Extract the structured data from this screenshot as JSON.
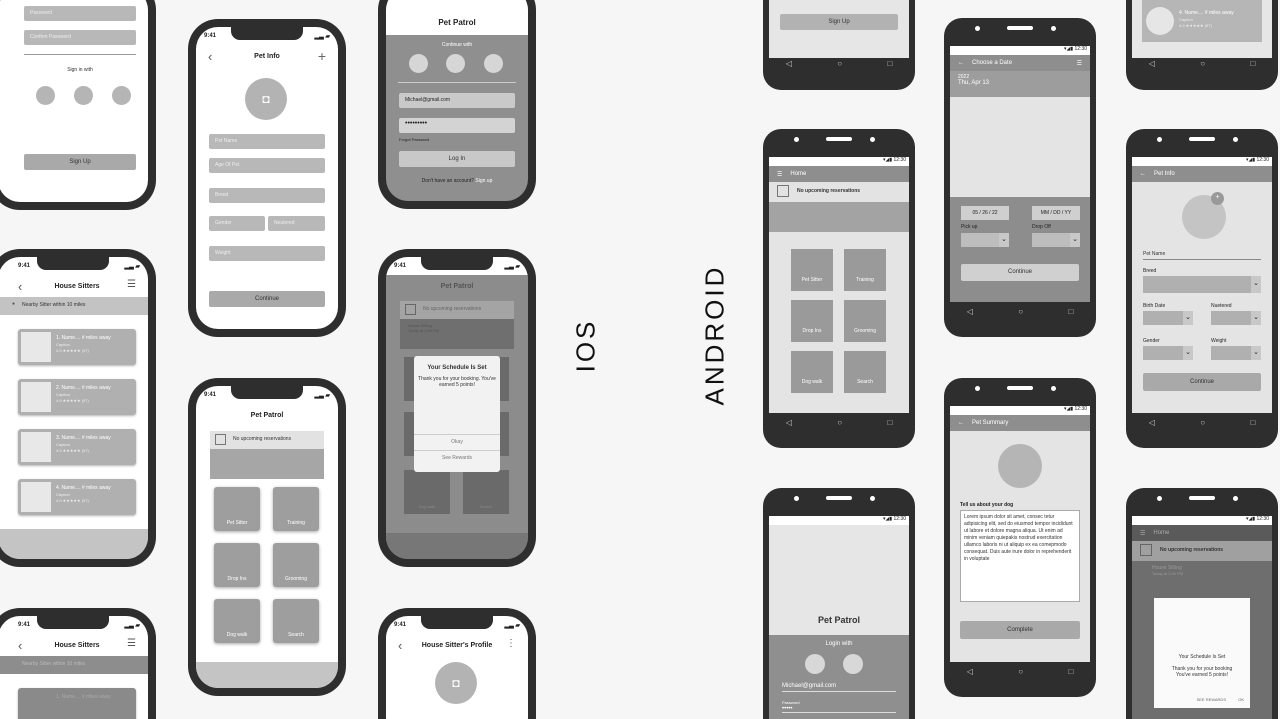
{
  "labels": {
    "ios": "IOS",
    "android": "ANDROID"
  },
  "time": "9:41",
  "android_time": "12:30",
  "icons": {
    "signal": "signal-wifi-battery-icon"
  },
  "ios1": {
    "password": "Password",
    "confirm": "Confirm Password",
    "sign_in_with": "Sign in with",
    "signup": "Sign Up"
  },
  "ios_petinfo": {
    "title": "Pet Info",
    "fields": [
      "Pet Name",
      "Age Of Pet",
      "Breed",
      "Gender",
      "Neutered",
      "Weight"
    ],
    "continue": "Continue"
  },
  "ios_login": {
    "title": "Pet Patrol",
    "continue_with": "Continue with",
    "email": "Michael@gmail.com",
    "password": "•••••••••",
    "forgot": "Forgot Password",
    "login": "Log In",
    "no_account": "Don't have an account?",
    "signup_link": "Sign up"
  },
  "ios_sitters": {
    "title": "House Sitters",
    "nearby": "Nearby Sitter within 10 miles",
    "items": [
      {
        "name": "1. Name.... # miles away",
        "caption": "Caption",
        "stars": "4.9 ★★★★★ (97)"
      },
      {
        "name": "2. Name.... # miles away",
        "caption": "Caption",
        "stars": "4.9 ★★★★★ (97)"
      },
      {
        "name": "3. Name.... # miles away",
        "caption": "Caption",
        "stars": "4.9 ★★★★★ (97)"
      },
      {
        "name": "4. Name.... # miles away",
        "caption": "Caption",
        "stars": "4.9 ★★★★★ (97)"
      }
    ]
  },
  "ios_home": {
    "title": "Pet Patrol",
    "reservations": "No upcoming reservations",
    "tiles": [
      "Pet Sitter",
      "Training",
      "Drop Ins",
      "Grooming",
      "Dog walk",
      "Search"
    ]
  },
  "ios_modal": {
    "title": "Pet Patrol",
    "reservations": "No upcoming reservations",
    "house_sitting": "House Sitting",
    "today": "Today at 3:00 PM",
    "modal_title": "Your Schedule Is Set",
    "modal_body": "Thank you for your booking. You've earned 5 points!",
    "okay": "Okay",
    "rewards": "See Rewards",
    "tile_a": "Dog walk",
    "tile_b": "Search"
  },
  "ios_sitters2": {
    "title": "House Sitters",
    "nearby": "Nearby Sitter within 10 miles",
    "item": "1. Name.... # miles away"
  },
  "ios_profile": {
    "title": "House Sitter's Profile"
  },
  "and_signup": {
    "signup": "Sign Up"
  },
  "and_date": {
    "title": "Choose a Date",
    "year": "2022",
    "date": "Thu, Apr 13",
    "d1": "05 / 26 / 22",
    "d2": "MM / DD / YY",
    "pickup": "Pick up",
    "dropoff": "Drop Off",
    "continue": "Continue"
  },
  "and_list": {
    "name": "4. Name.... # miles away",
    "caption": "Caption",
    "stars": "4.9 ★★★★★ (97)"
  },
  "and_home": {
    "title": "Home",
    "reservations": "No upcoming reservations",
    "tiles": [
      "Pet Sitter",
      "Training",
      "Drop Ins",
      "Grooming",
      "Dog walk",
      "Search"
    ]
  },
  "and_summary": {
    "title": "Pet Summary",
    "prompt": "Tell us about your dog",
    "body": "Lorem ipsum dolor sit amet, consec tetur adipisicing elit, sed do eiusmod tempor incididunt ut labore et dolore magna aliqua. Ut enim ad minim veniam quiepakis nostrud exercitation ullamco laboris ni ut aliquip ex ea comepmodo consequat. Duis aute irure dolor in reprehenderit in voluptate",
    "complete": "Complete"
  },
  "and_petinfo": {
    "title": "Pet Info",
    "name": "Pet Name",
    "breed": "Breed",
    "birth": "Birth Date",
    "neutered": "Nuetered",
    "gender": "Gender",
    "weight": "Weight",
    "continue": "Continue"
  },
  "and_login": {
    "title": "Pet Patrol",
    "login_with": "Login with",
    "email": "Michael@gmail.com",
    "password_label": "Password",
    "password": "•••••"
  },
  "and_modal": {
    "title": "Home",
    "reservations": "No upcoming reservations",
    "house_sitting": "House Sitting",
    "today": "Today at 3:00 PM",
    "modal_title": "Your Schedule Is Set",
    "modal_body": "Thank you for your booking You've earned 5 points!",
    "rewards": "SEE REWARDS",
    "ok": "OK"
  }
}
